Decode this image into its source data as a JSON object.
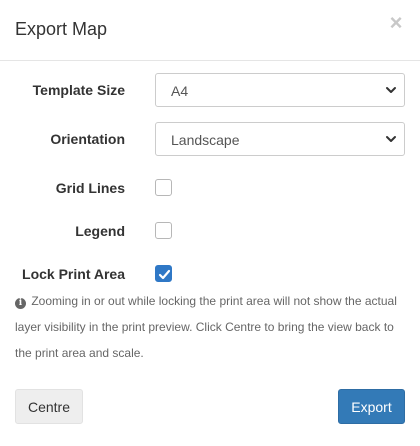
{
  "dialog": {
    "title": "Export Map",
    "close_glyph": "×"
  },
  "form": {
    "template_size": {
      "label": "Template Size",
      "value": "A4"
    },
    "orientation": {
      "label": "Orientation",
      "value": "Landscape"
    },
    "grid_lines": {
      "label": "Grid Lines",
      "checked": false
    },
    "legend": {
      "label": "Legend",
      "checked": false
    },
    "lock_print_area": {
      "label": "Lock Print Area",
      "checked": true
    }
  },
  "info": {
    "icon": "info-circle-icon",
    "text": "Zooming in or out while locking the print area will not show the actual layer visibility in the print preview. Click Centre to bring the view back to the print area and scale."
  },
  "buttons": {
    "centre": "Centre",
    "export": "Export"
  },
  "colors": {
    "primary": "#337ab7",
    "checkbox_checked": "#2f78c6"
  }
}
